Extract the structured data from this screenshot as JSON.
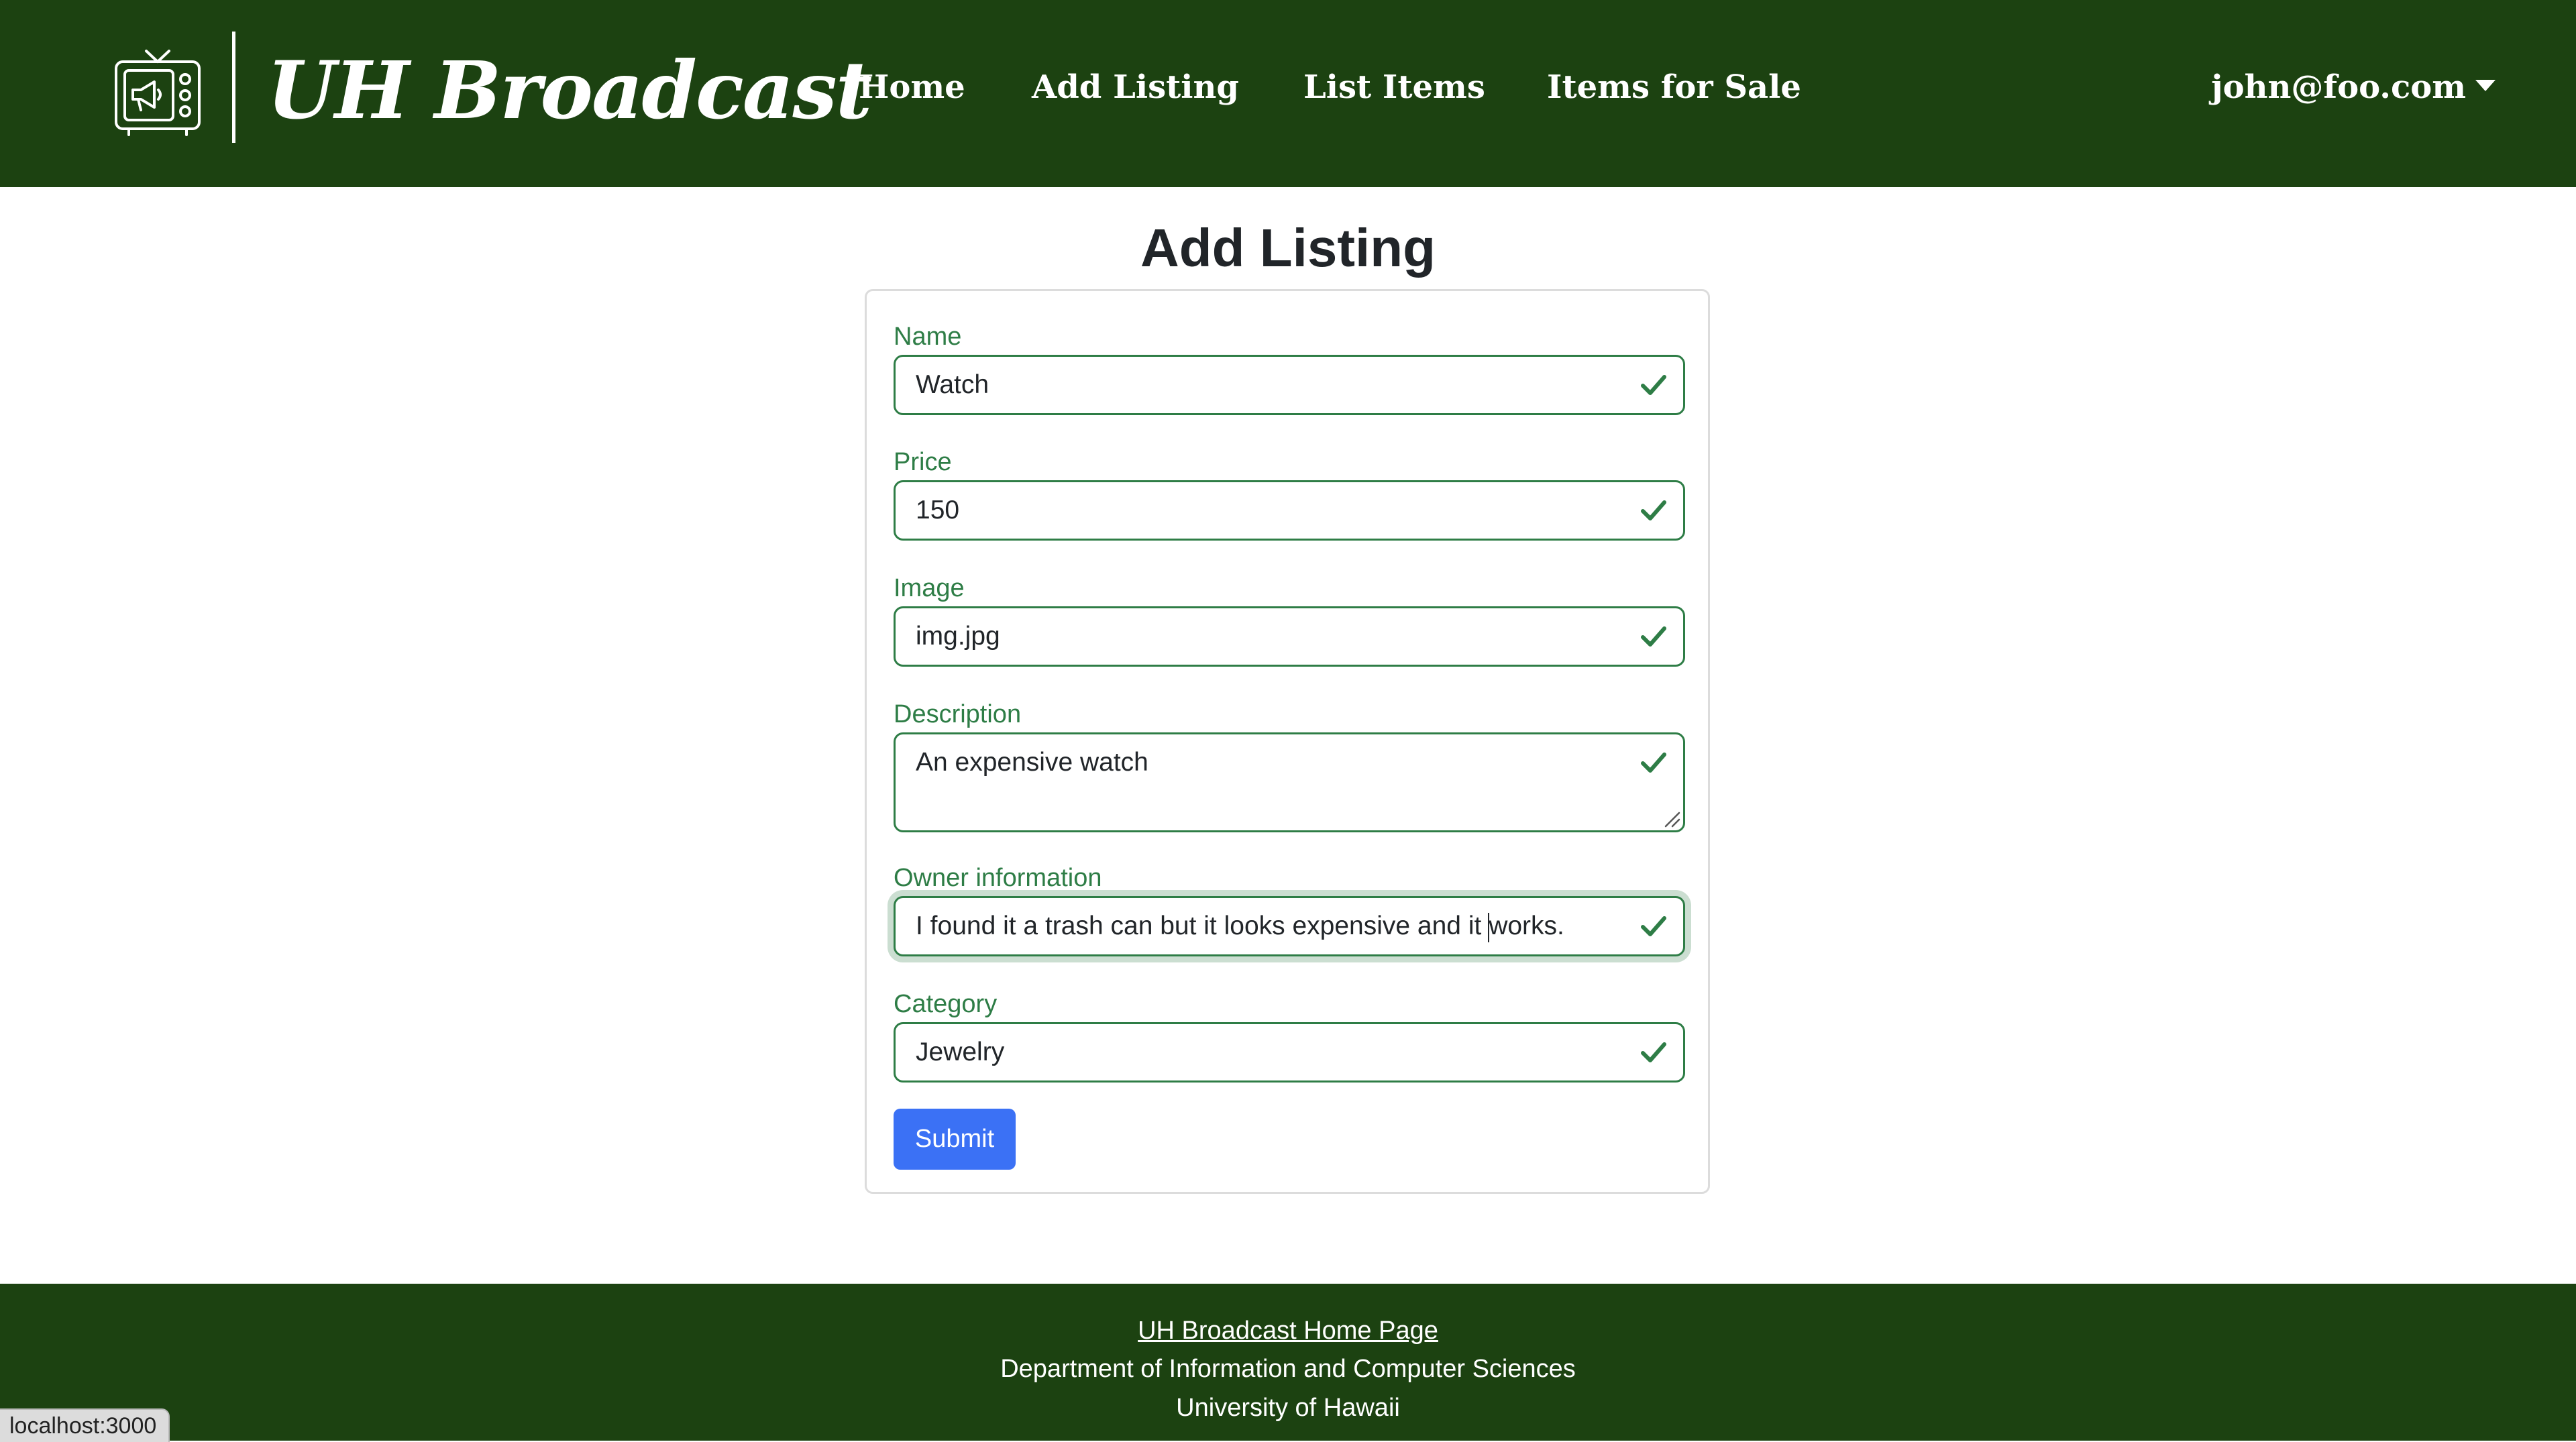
{
  "header": {
    "brand": "UH Broadcast",
    "nav": [
      "Home",
      "Add Listing",
      "List Items",
      "Items for Sale"
    ],
    "user": "john@foo.com",
    "logo_icon": "tv-megaphone-icon",
    "bg_color": "#1c4211"
  },
  "page": {
    "title": "Add Listing"
  },
  "form": {
    "fields": {
      "name": {
        "label": "Name",
        "value": "Watch"
      },
      "price": {
        "label": "Price",
        "value": "150"
      },
      "image": {
        "label": "Image",
        "value": "img.jpg"
      },
      "description": {
        "label": "Description",
        "value": "An expensive watch"
      },
      "owner": {
        "label": "Owner information",
        "value_before_cursor": "I found it a trash can but it looks expensive and it ",
        "value_after_cursor": "works."
      },
      "category": {
        "label": "Category",
        "value": "Jewelry"
      }
    },
    "valid_icon": "checkmark-icon",
    "valid_color": "#2e7d46",
    "submit_label": "Submit",
    "submit_color": "#3b71f5"
  },
  "footer": {
    "link": "UH Broadcast Home Page",
    "line2": "Department of Information and Computer Sciences",
    "line3": "University of Hawaii"
  },
  "status_bar": {
    "url": "localhost:3000"
  }
}
